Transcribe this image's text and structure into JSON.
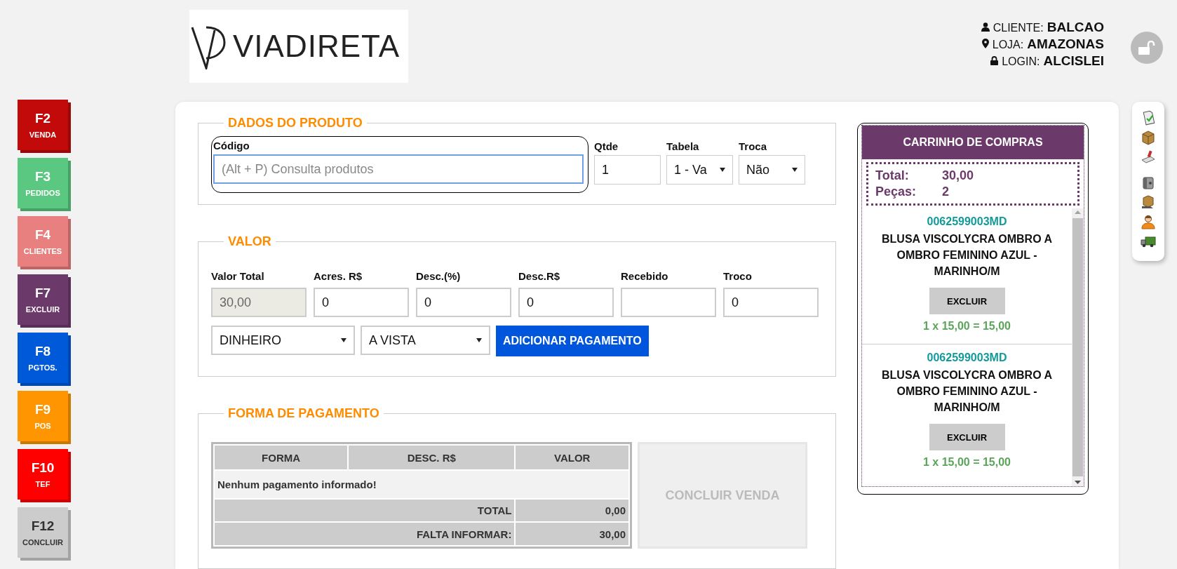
{
  "logo": {
    "text": "VIADIRETA"
  },
  "user_info": [
    {
      "kind": "user",
      "label": "CLIENTE:",
      "value": "BALCAO"
    },
    {
      "kind": "store",
      "label": "LOJA:",
      "value": "AMAZONAS"
    },
    {
      "kind": "login",
      "label": "LOGIN:",
      "value": "ALCISLEI"
    }
  ],
  "shortcuts": [
    {
      "key": "F2",
      "label": "VENDA",
      "color": "#c20a0a"
    },
    {
      "key": "F3",
      "label": "PEDIDOS",
      "color": "#5ac880"
    },
    {
      "key": "F4",
      "label": "CLIENTES",
      "color": "#e88080"
    },
    {
      "key": "F7",
      "label": "EXCLUIR",
      "color": "#6b3a6b"
    },
    {
      "key": "F8",
      "label": "PGTOS.",
      "color": "#0059d9"
    },
    {
      "key": "F9",
      "label": "POS",
      "color": "#ff9500"
    },
    {
      "key": "F10",
      "label": "TEF",
      "color": "#ff0000"
    },
    {
      "key": "F12",
      "label": "CONCLUIR",
      "color": "#cccccc"
    }
  ],
  "produto": {
    "legend": "DADOS DO PRODUTO",
    "codigo": {
      "label": "Código",
      "placeholder": "(Alt + P) Consulta produtos"
    },
    "qtde": {
      "label": "Qtde",
      "value": "1"
    },
    "tabela": {
      "label": "Tabela",
      "value": "1 - Va"
    },
    "troca": {
      "label": "Troca",
      "value": "Não"
    }
  },
  "valor": {
    "legend": "VALOR",
    "fields": [
      {
        "label": "Valor Total",
        "value": "30,00",
        "disabled": true
      },
      {
        "label": "Acres. R$",
        "value": "0",
        "disabled": false
      },
      {
        "label": "Desc.(%)",
        "value": "0",
        "disabled": false
      },
      {
        "label": "Desc.R$",
        "value": "0",
        "disabled": false
      },
      {
        "label": "Recebido",
        "disabled": false
      },
      {
        "label": "Troco",
        "value": "0",
        "disabled": false
      }
    ],
    "forma": "DINHEIRO",
    "condicao": "A VISTA",
    "add_button": "ADICIONAR PAGAMENTO"
  },
  "pagamento": {
    "legend": "FORMA DE PAGAMENTO",
    "columns": [
      "FORMA",
      "DESC. R$",
      "VALOR"
    ],
    "empty_message": "Nenhum pagamento informado!",
    "totals": [
      {
        "label": "TOTAL",
        "value": "0,00"
      },
      {
        "label": "FALTA INFORMAR:",
        "value": "30,00"
      }
    ],
    "conclude_button": {
      "label": "CONCLUIR VENDA",
      "disabled": true
    }
  },
  "cart": {
    "title": "CARRINHO DE COMPRAS",
    "summary": [
      {
        "label": "Total:",
        "value": "30,00"
      },
      {
        "label": "Peças:",
        "value": "2"
      }
    ],
    "items": [
      {
        "code": "0062599003MD",
        "name": "BLUSA VISCOLYCRA OMBRO A OMBRO FEMININO AZUL - MARINHO/M",
        "button": "EXCLUIR",
        "price": "1 x 15,00 = 15,00"
      },
      {
        "code": "0062599003MD",
        "name": "BLUSA VISCOLYCRA OMBRO A OMBRO FEMININO AZUL - MARINHO/M",
        "button": "EXCLUIR",
        "price": "1 x 15,00 = 15,00"
      }
    ]
  },
  "toolbar": [
    {
      "kind": "document"
    },
    {
      "kind": "box"
    },
    {
      "kind": "stamp"
    },
    {
      "kind": "safe"
    },
    {
      "kind": "box-hand"
    },
    {
      "kind": "person"
    },
    {
      "kind": "truck"
    }
  ]
}
